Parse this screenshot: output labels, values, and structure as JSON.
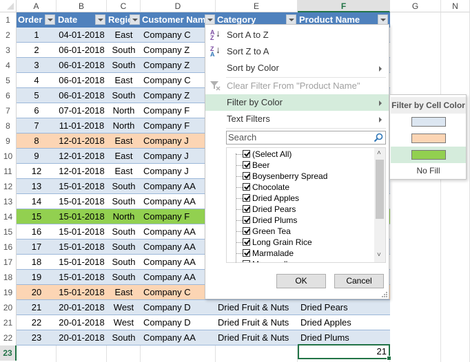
{
  "columns": [
    "A",
    "B",
    "C",
    "D",
    "E",
    "F",
    "G",
    "N"
  ],
  "selected_column": "F",
  "row_numbers": [
    "1",
    "2",
    "3",
    "4",
    "5",
    "6",
    "7",
    "8",
    "9",
    "10",
    "11",
    "12",
    "13",
    "14",
    "15",
    "16",
    "17",
    "18",
    "19",
    "20",
    "21",
    "22",
    "23"
  ],
  "selected_row": "23",
  "headers": [
    "Order",
    "Date",
    "Region",
    "Customer Name",
    "Category",
    "Product Name"
  ],
  "rows": [
    {
      "order": "1",
      "date": "04-01-2018",
      "region": "East",
      "customer": "Company C",
      "category": "",
      "product": "",
      "fill": "band"
    },
    {
      "order": "2",
      "date": "06-01-2018",
      "region": "South",
      "customer": "Company Z",
      "category": "",
      "product": "",
      "fill": "white"
    },
    {
      "order": "3",
      "date": "06-01-2018",
      "region": "South",
      "customer": "Company Z",
      "category": "",
      "product": "",
      "fill": "band"
    },
    {
      "order": "4",
      "date": "06-01-2018",
      "region": "East",
      "customer": "Company C",
      "category": "",
      "product": "",
      "fill": "white"
    },
    {
      "order": "5",
      "date": "06-01-2018",
      "region": "South",
      "customer": "Company Z",
      "category": "",
      "product": "",
      "fill": "band"
    },
    {
      "order": "6",
      "date": "07-01-2018",
      "region": "North",
      "customer": "Company F",
      "category": "",
      "product": "",
      "fill": "white"
    },
    {
      "order": "7",
      "date": "11-01-2018",
      "region": "North",
      "customer": "Company F",
      "category": "",
      "product": "",
      "fill": "band"
    },
    {
      "order": "8",
      "date": "12-01-2018",
      "region": "East",
      "customer": "Company J",
      "category": "",
      "product": "",
      "fill": "peach"
    },
    {
      "order": "9",
      "date": "12-01-2018",
      "region": "East",
      "customer": "Company J",
      "category": "",
      "product": "",
      "fill": "band"
    },
    {
      "order": "12",
      "date": "12-01-2018",
      "region": "East",
      "customer": "Company J",
      "category": "",
      "product": "",
      "fill": "white"
    },
    {
      "order": "13",
      "date": "15-01-2018",
      "region": "South",
      "customer": "Company AA",
      "category": "",
      "product": "",
      "fill": "band"
    },
    {
      "order": "14",
      "date": "15-01-2018",
      "region": "South",
      "customer": "Company AA",
      "category": "",
      "product": "",
      "fill": "white"
    },
    {
      "order": "15",
      "date": "15-01-2018",
      "region": "North",
      "customer": "Company F",
      "category": "",
      "product": "",
      "fill": "green"
    },
    {
      "order": "16",
      "date": "15-01-2018",
      "region": "South",
      "customer": "Company AA",
      "category": "",
      "product": "",
      "fill": "white"
    },
    {
      "order": "17",
      "date": "15-01-2018",
      "region": "South",
      "customer": "Company AA",
      "category": "",
      "product": "",
      "fill": "band"
    },
    {
      "order": "18",
      "date": "15-01-2018",
      "region": "South",
      "customer": "Company AA",
      "category": "",
      "product": "",
      "fill": "white"
    },
    {
      "order": "19",
      "date": "15-01-2018",
      "region": "South",
      "customer": "Company AA",
      "category": "",
      "product": "",
      "fill": "band"
    },
    {
      "order": "20",
      "date": "15-01-2018",
      "region": "East",
      "customer": "Company C",
      "category": "",
      "product": "",
      "fill": "peach"
    },
    {
      "order": "21",
      "date": "20-01-2018",
      "region": "West",
      "customer": "Company D",
      "category": "Dried Fruit & Nuts",
      "product": "Dried Pears",
      "fill": "band"
    },
    {
      "order": "22",
      "date": "20-01-2018",
      "region": "West",
      "customer": "Company D",
      "category": "Dried Fruit & Nuts",
      "product": "Dried Apples",
      "fill": "white"
    },
    {
      "order": "23",
      "date": "20-01-2018",
      "region": "South",
      "customer": "Company AA",
      "category": "Dried Fruit & Nuts",
      "product": "Dried Plums",
      "fill": "band"
    }
  ],
  "active_cell_value": "21",
  "filter_menu": {
    "sort_az": "Sort A to Z",
    "sort_za": "Sort Z to A",
    "sort_by_color": "Sort by Color",
    "clear_filter": "Clear Filter From \"Product Name\"",
    "filter_by_color": "Filter by Color",
    "text_filters": "Text Filters",
    "search_placeholder": "Search",
    "items": [
      "(Select All)",
      "Beer",
      "Boysenberry Spread",
      "Chocolate",
      "Dried Apples",
      "Dried Pears",
      "Dried Plums",
      "Green Tea",
      "Long Grain Rice",
      "Marmalade",
      "Mozzarella"
    ],
    "ok": "OK",
    "cancel": "Cancel"
  },
  "color_submenu": {
    "title": "Filter by Cell Color",
    "swatches": [
      "#dce6f1",
      "#fcd5b4",
      "#92d050"
    ],
    "no_fill": "No Fill"
  },
  "colors": {
    "header_fill": "#4f81bd",
    "band_fill": "#dce6f1",
    "accent_green": "#217346",
    "highlight": "#d5ecdc"
  }
}
